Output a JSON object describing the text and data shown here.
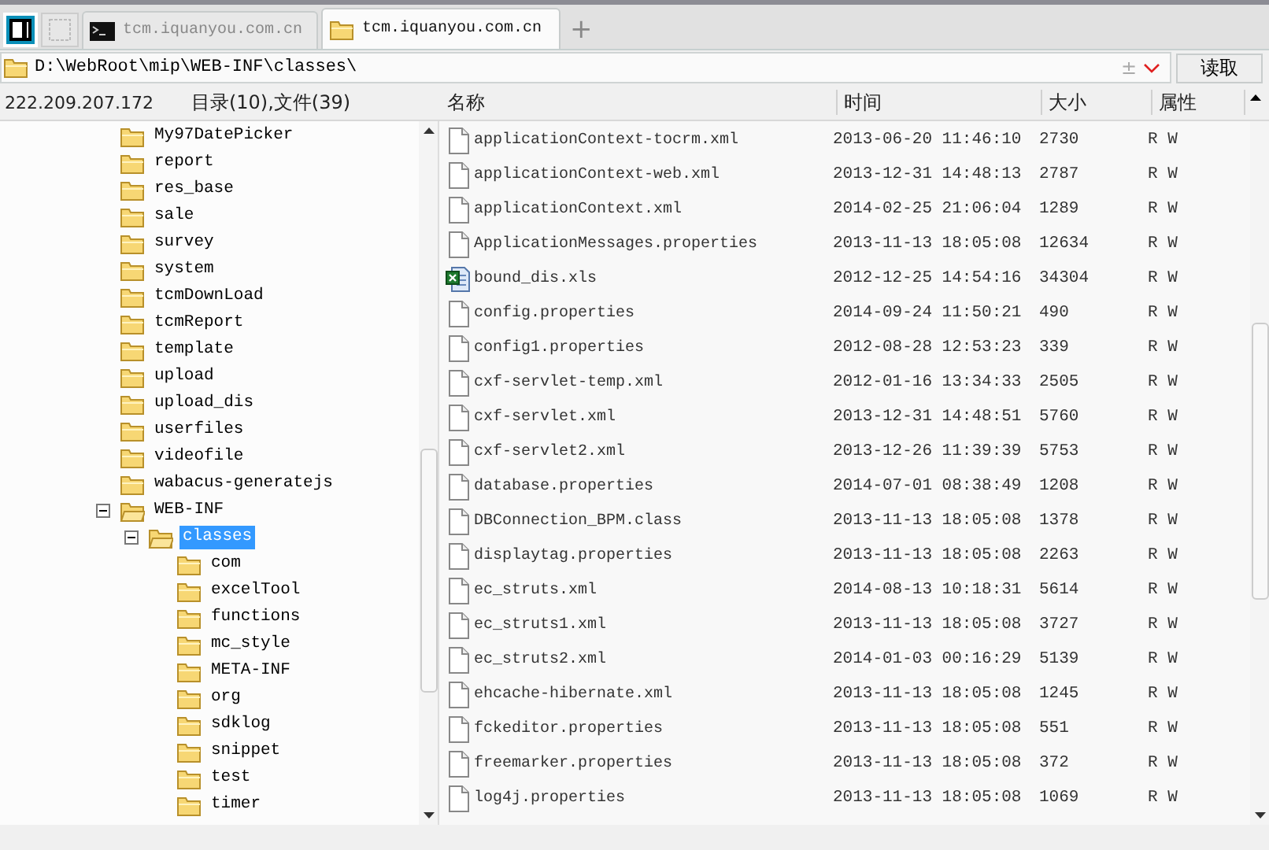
{
  "tabs": [
    {
      "label": "tcm.iquanyou.com.cn",
      "kind": "terminal",
      "selected": false
    },
    {
      "label": "tcm.iquanyou.com.cn",
      "kind": "folder",
      "selected": true
    }
  ],
  "new_tab": "+",
  "path_bar": {
    "value": "D:\\WebRoot\\mip\\WEB-INF\\classes\\",
    "toggle": "±",
    "button": "读取"
  },
  "status": {
    "host": "222.209.207.172",
    "counts": "目录(10),文件(39)"
  },
  "tree": [
    {
      "name": "My97DatePicker",
      "selected": false
    },
    {
      "name": "report",
      "selected": false
    },
    {
      "name": "res_base",
      "selected": false
    },
    {
      "name": "sale",
      "selected": false
    },
    {
      "name": "survey",
      "selected": false
    },
    {
      "name": "system",
      "selected": false
    },
    {
      "name": "tcmDownLoad",
      "selected": false
    },
    {
      "name": "tcmReport",
      "selected": false
    },
    {
      "name": "template",
      "selected": false
    },
    {
      "name": "upload",
      "selected": false
    },
    {
      "name": "upload_dis",
      "selected": false
    },
    {
      "name": "userfiles",
      "selected": false
    },
    {
      "name": "videofile",
      "selected": false
    },
    {
      "name": "wabacus-generatejs",
      "selected": false
    },
    {
      "name": "WEB-INF",
      "selected": false,
      "expanded": true,
      "children": [
        {
          "name": "classes",
          "selected": true,
          "expanded": true,
          "children": [
            {
              "name": "com",
              "selected": false
            },
            {
              "name": "excelTool",
              "selected": false
            },
            {
              "name": "functions",
              "selected": false
            },
            {
              "name": "mc_style",
              "selected": false
            },
            {
              "name": "META-INF",
              "selected": false
            },
            {
              "name": "org",
              "selected": false
            },
            {
              "name": "sdklog",
              "selected": false
            },
            {
              "name": "snippet",
              "selected": false
            },
            {
              "name": "test",
              "selected": false
            },
            {
              "name": "timer",
              "selected": false
            }
          ]
        }
      ]
    }
  ],
  "table": {
    "columns": [
      "名称",
      "时间",
      "大小",
      "属性"
    ],
    "rows": [
      {
        "kind": "document",
        "name": "applicationContext-tocrm.xml",
        "time": "2013-06-20 11:46:10",
        "size": "2730",
        "attr": "R W"
      },
      {
        "kind": "document",
        "name": "applicationContext-web.xml",
        "time": "2013-12-31 14:48:13",
        "size": "2787",
        "attr": "R W"
      },
      {
        "kind": "document",
        "name": "applicationContext.xml",
        "time": "2014-02-25 21:06:04",
        "size": "1289",
        "attr": "R W"
      },
      {
        "kind": "document",
        "name": "ApplicationMessages.properties",
        "time": "2013-11-13 18:05:08",
        "size": "12634",
        "attr": "R W"
      },
      {
        "kind": "spreadsheet",
        "name": "bound_dis.xls",
        "time": "2012-12-25 14:54:16",
        "size": "34304",
        "attr": "R W"
      },
      {
        "kind": "document",
        "name": "config.properties",
        "time": "2014-09-24 11:50:21",
        "size": "490",
        "attr": "R W"
      },
      {
        "kind": "document",
        "name": "config1.properties",
        "time": "2012-08-28 12:53:23",
        "size": "339",
        "attr": "R W"
      },
      {
        "kind": "document",
        "name": "cxf-servlet-temp.xml",
        "time": "2012-01-16 13:34:33",
        "size": "2505",
        "attr": "R W"
      },
      {
        "kind": "document",
        "name": "cxf-servlet.xml",
        "time": "2013-12-31 14:48:51",
        "size": "5760",
        "attr": "R W"
      },
      {
        "kind": "document",
        "name": "cxf-servlet2.xml",
        "time": "2013-12-26 11:39:39",
        "size": "5753",
        "attr": "R W"
      },
      {
        "kind": "document",
        "name": "database.properties",
        "time": "2014-07-01 08:38:49",
        "size": "1208",
        "attr": "R W"
      },
      {
        "kind": "document",
        "name": "DBConnection_BPM.class",
        "time": "2013-11-13 18:05:08",
        "size": "1378",
        "attr": "R W"
      },
      {
        "kind": "document",
        "name": "displaytag.properties",
        "time": "2013-11-13 18:05:08",
        "size": "2263",
        "attr": "R W"
      },
      {
        "kind": "document",
        "name": "ec_struts.xml",
        "time": "2014-08-13 10:18:31",
        "size": "5614",
        "attr": "R W"
      },
      {
        "kind": "document",
        "name": "ec_struts1.xml",
        "time": "2013-11-13 18:05:08",
        "size": "3727",
        "attr": "R W"
      },
      {
        "kind": "document",
        "name": "ec_struts2.xml",
        "time": "2014-01-03 00:16:29",
        "size": "5139",
        "attr": "R W"
      },
      {
        "kind": "document",
        "name": "ehcache-hibernate.xml",
        "time": "2013-11-13 18:05:08",
        "size": "1245",
        "attr": "R W"
      },
      {
        "kind": "document",
        "name": "fckeditor.properties",
        "time": "2013-11-13 18:05:08",
        "size": "551",
        "attr": "R W"
      },
      {
        "kind": "document",
        "name": "freemarker.properties",
        "time": "2013-11-13 18:05:08",
        "size": "372",
        "attr": "R W"
      },
      {
        "kind": "document",
        "name": "log4j.properties",
        "time": "2013-11-13 18:05:08",
        "size": "1069",
        "attr": "R W"
      }
    ]
  }
}
